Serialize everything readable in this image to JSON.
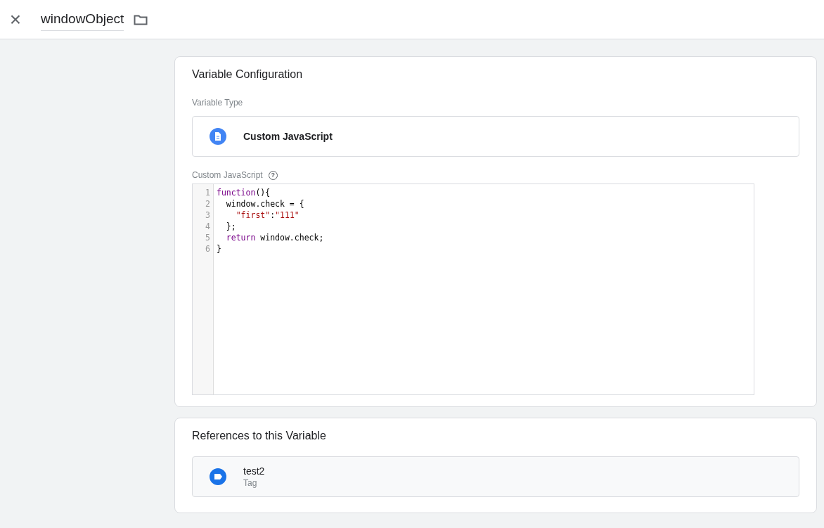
{
  "header": {
    "close_icon": "×",
    "title": "windowObject"
  },
  "configuration": {
    "heading": "Variable Configuration",
    "type_label": "Variable Type",
    "type_value": "Custom JavaScript",
    "code_label": "Custom JavaScript",
    "help_icon": "?",
    "code_lines": [
      {
        "number": "1",
        "tokens": [
          {
            "kind": "keyword",
            "text": "function"
          },
          {
            "kind": "plain",
            "text": "(){"
          }
        ]
      },
      {
        "number": "2",
        "tokens": [
          {
            "kind": "plain",
            "text": "  window.check = {"
          }
        ]
      },
      {
        "number": "3",
        "tokens": [
          {
            "kind": "string",
            "text": "    \"first\""
          },
          {
            "kind": "plain",
            "text": ":"
          },
          {
            "kind": "string",
            "text": "\"111\""
          }
        ]
      },
      {
        "number": "4",
        "tokens": [
          {
            "kind": "plain",
            "text": "  };"
          }
        ]
      },
      {
        "number": "5",
        "tokens": [
          {
            "kind": "keyword",
            "text": "  return"
          },
          {
            "kind": "plain",
            "text": " window.check;"
          }
        ]
      },
      {
        "number": "6",
        "tokens": [
          {
            "kind": "plain",
            "text": "}"
          }
        ]
      }
    ]
  },
  "references": {
    "heading": "References to this Variable",
    "items": [
      {
        "name": "test2",
        "type": "Tag"
      }
    ]
  }
}
